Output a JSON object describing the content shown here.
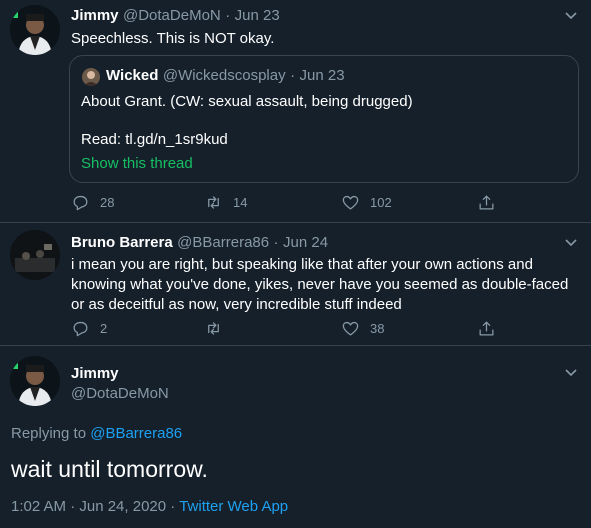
{
  "tweet1": {
    "name": "Jimmy",
    "handle": "@DotaDeMoN",
    "sep": "·",
    "date": "Jun 23",
    "text": "Speechless. This is NOT okay.",
    "quote": {
      "name": "Wicked",
      "handle": "@Wickedscosplay",
      "sep": "·",
      "date": "Jun 23",
      "text": "About Grant. (CW: sexual assault, being drugged)",
      "read_text": "Read: tl.gd/n_1sr9kud",
      "show_thread": "Show this thread"
    },
    "replies": "28",
    "retweets": "14",
    "likes": "102"
  },
  "tweet2": {
    "name": "Bruno Barrera",
    "handle": "@BBarrera86",
    "sep": "·",
    "date": "Jun 24",
    "text": "i mean you are right, but speaking like that after your own actions and knowing what you've done, yikes, never have you seemed as double-faced or as deceitful as now, very incredible stuff indeed",
    "replies": "2",
    "retweets": "",
    "likes": "38"
  },
  "main_tweet": {
    "name": "Jimmy",
    "handle": "@DotaDeMoN",
    "replying_prefix": "Replying to",
    "replying_handle": "@BBarrera86",
    "text": "wait until tomorrow.",
    "timestamp": "1:02 AM · Jun 24, 2020",
    "sep": "·",
    "source": "Twitter Web App"
  },
  "colors": {
    "background": "#15202b",
    "muted": "#8899a6",
    "link": "#1da1f2",
    "green": "#17bf63",
    "border": "#38444d"
  }
}
